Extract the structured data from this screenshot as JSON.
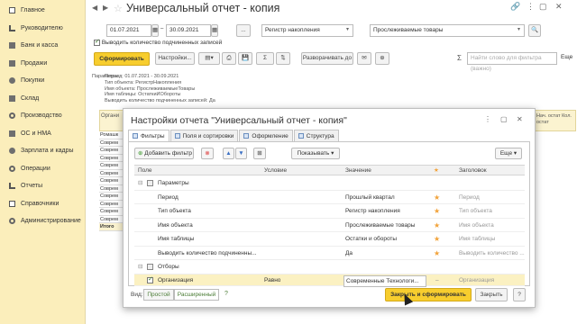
{
  "sidebar": {
    "items": [
      {
        "label": "Главное",
        "icon": "menu-icon"
      },
      {
        "label": "Руководителю",
        "icon": "chart-icon"
      },
      {
        "label": "Банк и касса",
        "icon": "bank-icon"
      },
      {
        "label": "Продажи",
        "icon": "sales-icon"
      },
      {
        "label": "Покупки",
        "icon": "cart-icon"
      },
      {
        "label": "Склад",
        "icon": "warehouse-icon"
      },
      {
        "label": "Производство",
        "icon": "factory-icon"
      },
      {
        "label": "ОС и НМА",
        "icon": "assets-icon"
      },
      {
        "label": "Зарплата и кадры",
        "icon": "people-icon"
      },
      {
        "label": "Операции",
        "icon": "operations-icon"
      },
      {
        "label": "Отчеты",
        "icon": "reports-icon"
      },
      {
        "label": "Справочники",
        "icon": "book-icon"
      },
      {
        "label": "Администрирование",
        "icon": "gear-icon"
      }
    ]
  },
  "header": {
    "title": "Универсальный отчет - копия"
  },
  "filters": {
    "date_from": "01.07.2021",
    "date_to": "30.09.2021",
    "dots": "...",
    "source": "Регистр накопления",
    "object": "Прослеживаемые товары",
    "show_subordinates": "Выводить количество подчиненных записей"
  },
  "toolbar": {
    "generate": "Сформировать",
    "settings": "Настройки...",
    "expand": "Разворачивать до",
    "search_placeholder": "Найти слово для фильтра (важно)",
    "more": "Еще",
    "sigma": "Σ"
  },
  "report": {
    "params_label": "Параметры:",
    "params_lines": [
      "Период: 01.07.2021 - 30.09.2021",
      "Тип объекта: РегистрНакопления",
      "Имя объекта: ПрослеживаемыеТовары",
      "Имя таблицы: ОстаткиИОбороты",
      "Выводить количество подчиненных записей: Да"
    ],
    "col_head": "Органи",
    "right_head": "Нач. остат Кол. остат",
    "rows": [
      "Ромашк",
      "Соврем",
      "Соврем",
      "Соврем",
      "Соврем",
      "Соврем",
      "Соврем",
      "Соврем",
      "Соврем",
      "Соврем",
      "Соврем",
      "Соврем",
      "Итого"
    ]
  },
  "dialog": {
    "title": "Настройки отчета \"Универсальный отчет - копия\"",
    "tabs": [
      "Фильтры",
      "Поля и сортировки",
      "Оформление",
      "Структура"
    ],
    "add_filter": "Добавить фильтр",
    "show": "Показывать",
    "more": "Еще",
    "columns": {
      "field": "Поле",
      "condition": "Условие",
      "value": "Значение",
      "header": "Заголовок"
    },
    "rows": [
      {
        "field": "Параметры",
        "condition": "",
        "value": "",
        "header": "",
        "group": true
      },
      {
        "field": "Период",
        "condition": "",
        "value": "Прошлый квартал",
        "header": "Период",
        "group": false
      },
      {
        "field": "Тип объекта",
        "condition": "",
        "value": "Регистр накопления",
        "header": "Тип объекта",
        "group": false
      },
      {
        "field": "Имя объекта",
        "condition": "",
        "value": "Прослеживаемые товары",
        "header": "Имя объекта",
        "group": false
      },
      {
        "field": "Имя таблицы",
        "condition": "",
        "value": "Остатки и обороты",
        "header": "Имя таблицы",
        "group": false
      },
      {
        "field": "Выводить количество подчиненны...",
        "condition": "",
        "value": "Да",
        "header": "Выводить количество ...",
        "group": false
      },
      {
        "field": "Отборы",
        "condition": "",
        "value": "",
        "header": "",
        "group": true
      },
      {
        "field": "Организация",
        "condition": "Равно",
        "value": "Современные Технологи...",
        "header": "Организация",
        "group": false
      }
    ],
    "view_label": "Вид:",
    "view_simple": "Простой",
    "view_advanced": "Расширенный",
    "help": "?",
    "close_and_generate": "Закрыть и сформировать",
    "close": "Закрыть"
  }
}
